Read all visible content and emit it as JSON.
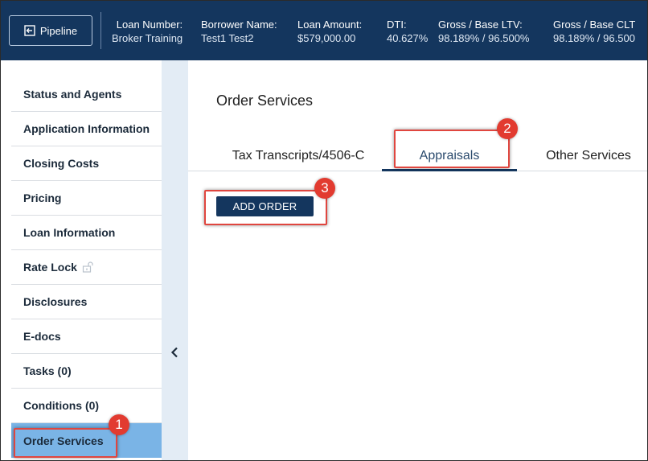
{
  "header": {
    "pipeline_label": "Pipeline",
    "fields": [
      {
        "label": "Loan Number:",
        "value": "Broker Training"
      },
      {
        "label": "Borrower Name:",
        "value": "Test1 Test2"
      },
      {
        "label": "Loan Amount:",
        "value": "$579,000.00"
      },
      {
        "label": "DTI:",
        "value": "40.627%"
      },
      {
        "label": "Gross / Base LTV:",
        "value": "98.189% / 96.500%"
      },
      {
        "label": "Gross / Base CLT",
        "value": "98.189% / 96.500"
      }
    ],
    "bg_color": "#14365e"
  },
  "sidebar": {
    "items": [
      {
        "label": "Status and Agents"
      },
      {
        "label": "Application Information"
      },
      {
        "label": "Closing Costs"
      },
      {
        "label": "Pricing"
      },
      {
        "label": "Loan Information"
      },
      {
        "label": "Rate Lock",
        "icon": "unlock-icon"
      },
      {
        "label": "Disclosures"
      },
      {
        "label": "E-docs"
      },
      {
        "label": "Tasks (0)"
      },
      {
        "label": "Conditions (0)"
      },
      {
        "label": "Order Services",
        "active": true
      }
    ],
    "active_color": "#7ab4e6",
    "collapse_icon": "chevron-left-icon"
  },
  "main": {
    "title": "Order Services",
    "tabs": [
      {
        "label": "Tax Transcripts/4506-C"
      },
      {
        "label": "Appraisals",
        "selected": true
      },
      {
        "label": "Other Services"
      }
    ],
    "add_order_label": "ADD ORDER"
  },
  "annotations": {
    "steps": [
      "1",
      "2",
      "3"
    ],
    "color": "#e23b30"
  }
}
